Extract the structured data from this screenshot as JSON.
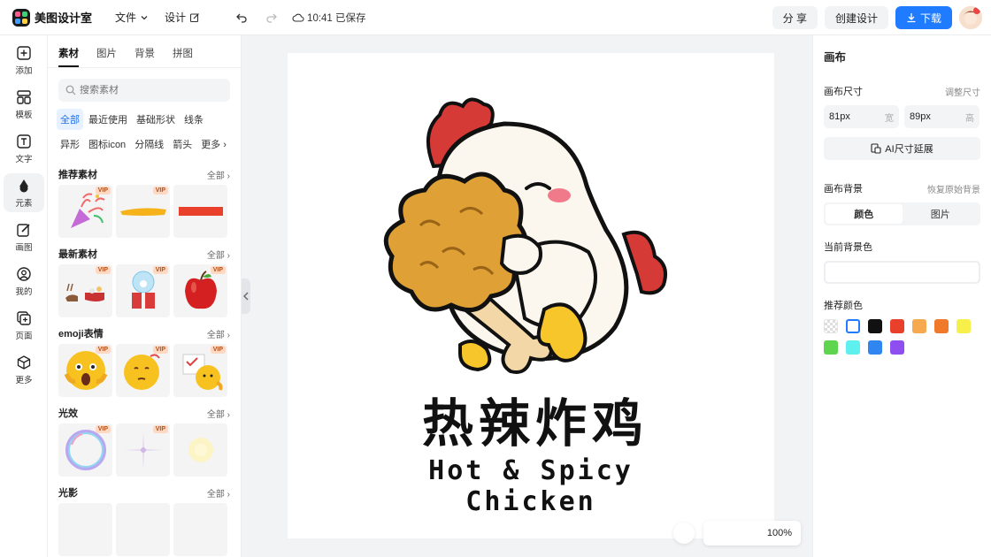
{
  "app": {
    "name": "美图设计室"
  },
  "menu": {
    "file": "文件",
    "design": "设计"
  },
  "status": {
    "saved": "10:41 已保存"
  },
  "actions": {
    "share": "分 享",
    "create": "创建设计",
    "download": "下载"
  },
  "rail": [
    {
      "label": "添加",
      "icon": "plus-square-icon"
    },
    {
      "label": "模板",
      "icon": "template-icon"
    },
    {
      "label": "文字",
      "icon": "text-icon"
    },
    {
      "label": "元素",
      "icon": "shapes-icon"
    },
    {
      "label": "画图",
      "icon": "draw-icon"
    },
    {
      "label": "我的",
      "icon": "user-icon"
    },
    {
      "label": "页面",
      "icon": "page-icon"
    },
    {
      "label": "更多",
      "icon": "cube-icon"
    }
  ],
  "panel": {
    "tabs": [
      "素材",
      "图片",
      "背景",
      "拼图"
    ],
    "search_placeholder": "搜索素材",
    "chips": [
      "全部",
      "最近使用",
      "基础形状",
      "线条",
      "异形",
      "图标icon",
      "分隔线",
      "箭头",
      "更多"
    ],
    "all_label": "全部",
    "vip_label": "VIP",
    "sections": [
      {
        "title": "推荐素材"
      },
      {
        "title": "最新素材"
      },
      {
        "title": "emoji表情"
      },
      {
        "title": "光效"
      },
      {
        "title": "光影"
      }
    ]
  },
  "canvas": {
    "title_cn": "热辣炸鸡",
    "title_en": "Hot & Spicy Chicken",
    "zoom": "100%"
  },
  "right": {
    "title": "画布",
    "size_label": "画布尺寸",
    "resize_link": "调整尺寸",
    "width_value": "81px",
    "width_unit": "宽",
    "height_value": "89px",
    "height_unit": "高",
    "ai_extend": "AI尺寸延展",
    "bg_label": "画布背景",
    "bg_reset": "恢复原始背景",
    "seg_color": "颜色",
    "seg_image": "图片",
    "current_bg": "当前背景色",
    "recommend": "推荐颜色",
    "swatches": [
      "transparent",
      "#ffffff",
      "#111111",
      "#e8402a",
      "#f6a94e",
      "#f07a2a",
      "#f7f04a",
      "#5fd44e",
      "#5ef0ee",
      "#2f86f0",
      "#8e4ef0"
    ]
  },
  "colors": {
    "accent": "#1f7bff",
    "chip_active": "#1f6fe8"
  }
}
